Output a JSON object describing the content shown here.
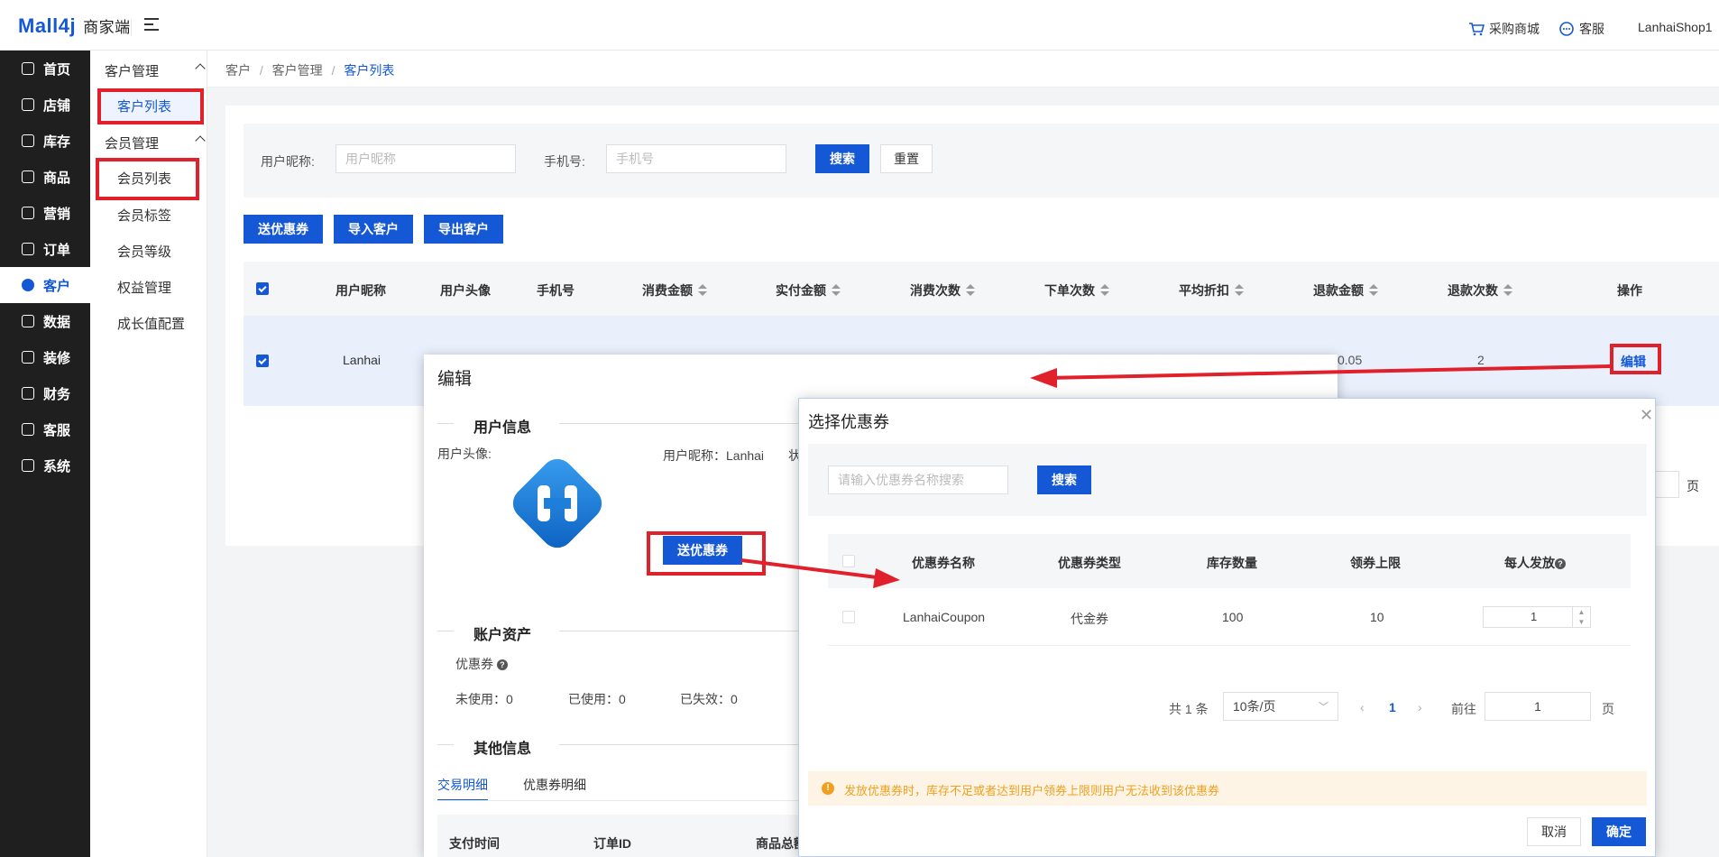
{
  "app": {
    "logo": "Mall4j",
    "logo_sub": "商家端"
  },
  "topbar": {
    "purchase": "采购商城",
    "service": "客服",
    "user": "LanhaiShop1"
  },
  "sidebar": [
    {
      "label": "首页",
      "icon": "home-icon"
    },
    {
      "label": "店铺",
      "icon": "shop-icon"
    },
    {
      "label": "库存",
      "icon": "stock-icon"
    },
    {
      "label": "商品",
      "icon": "goods-icon"
    },
    {
      "label": "营销",
      "icon": "gift-icon"
    },
    {
      "label": "订单",
      "icon": "order-icon"
    },
    {
      "label": "客户",
      "icon": "user-icon"
    },
    {
      "label": "数据",
      "icon": "data-icon"
    },
    {
      "label": "装修",
      "icon": "decorate-icon"
    },
    {
      "label": "财务",
      "icon": "finance-icon"
    },
    {
      "label": "客服",
      "icon": "chat-icon"
    },
    {
      "label": "系统",
      "icon": "gear-icon"
    }
  ],
  "subnav": {
    "group1": "客户管理",
    "customer_list": "客户列表",
    "group2": "会员管理",
    "member_list": "会员列表",
    "member_tag": "会员标签",
    "member_level": "会员等级",
    "rights": "权益管理",
    "growth": "成长值配置"
  },
  "breadcrumb": {
    "a": "客户",
    "b": "客户管理",
    "c": "客户列表",
    "sep": "/"
  },
  "filter": {
    "nick_label": "用户昵称:",
    "nick_ph": "用户昵称",
    "phone_label": "手机号:",
    "phone_ph": "手机号",
    "search": "搜索",
    "reset": "重置"
  },
  "actions": {
    "send": "送优惠券",
    "import": "导入客户",
    "export": "导出客户"
  },
  "table": {
    "headers": [
      "用户昵称",
      "用户头像",
      "手机号",
      "消费金额",
      "实付金额",
      "消费次数",
      "下单次数",
      "平均折扣",
      "退款金额",
      "退款次数",
      "操作"
    ],
    "row": {
      "nick": "Lanhai",
      "refund": "0.05",
      "refund_count": "2",
      "edit": "编辑"
    },
    "page_unit": "页"
  },
  "edit_dialog": {
    "title": "编辑",
    "user_info": "用户信息",
    "avatar_label": "用户头像:",
    "nick": "用户昵称：Lanhai",
    "cut": "状",
    "send": "送优惠券",
    "assets": "账户资产",
    "coupon": "优惠券",
    "unused": "未使用：0",
    "used": "已使用：0",
    "expired": "已失效：0",
    "other": "其他信息",
    "tab1": "交易明细",
    "tab2": "优惠券明细",
    "col1": "支付时间",
    "col2": "订单ID",
    "col3": "商品总额"
  },
  "coupon_dialog": {
    "title": "选择优惠券",
    "search_ph": "请输入优惠券名称搜索",
    "search": "搜索",
    "headers": [
      "优惠券名称",
      "优惠券类型",
      "库存数量",
      "领券上限",
      "每人发放"
    ],
    "row": {
      "name": "LanhaiCoupon",
      "type": "代金券",
      "stock": "100",
      "limit": "10",
      "qty": "1"
    },
    "total": "共 1 条",
    "page_size": "10条/页",
    "page": "1",
    "goto": "前往",
    "goto_val": "1",
    "page_unit": "页",
    "warning": "发放优惠券时，库存不足或者达到用户领券上限则用户无法收到该优惠券",
    "cancel": "取消",
    "confirm": "确定"
  },
  "colors": {
    "accent": "#1558d6",
    "annotation": "#e0202b",
    "warn": "#f0a020"
  }
}
